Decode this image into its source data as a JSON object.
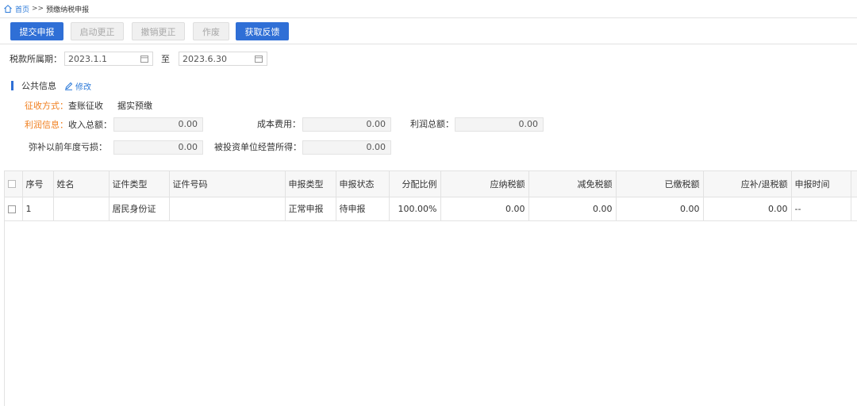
{
  "breadcrumb": {
    "home": "首页",
    "separator": ">>",
    "current": "预缴纳税申报"
  },
  "toolbar": {
    "submit": "提交申报",
    "start_correction": "启动更正",
    "cancel_correction": "撤销更正",
    "void": "作废",
    "get_feedback": "获取反馈"
  },
  "period": {
    "label": "税款所属期：",
    "start": "2023.1.1",
    "to": "至",
    "end": "2023.6.30"
  },
  "public_info": {
    "title": "公共信息",
    "edit": "修改"
  },
  "collection": {
    "label": "征收方式：",
    "value1": "查账征收",
    "value2": "据实预缴"
  },
  "profit": {
    "label": "利润信息：",
    "income_label": "收入总额：",
    "income": "0.00",
    "cost_label": "成本费用：",
    "cost": "0.00",
    "profit_label": "利润总额：",
    "profit": "0.00",
    "loss_label": "弥补以前年度亏损：",
    "loss": "0.00",
    "invest_label": "被投资单位经营所得：",
    "invest": "0.00"
  },
  "table": {
    "headers": [
      "序号",
      "姓名",
      "证件类型",
      "证件号码",
      "申报类型",
      "申报状态",
      "分配比例",
      "应纳税额",
      "减免税额",
      "已缴税额",
      "应补/退税额",
      "申报时间"
    ],
    "rows": [
      [
        "1",
        "",
        "居民身份证",
        "",
        "正常申报",
        "待申报",
        "100.00%",
        "0.00",
        "0.00",
        "0.00",
        "0.00",
        "--"
      ]
    ]
  },
  "colors": {
    "primary": "#2f6fd6",
    "link": "#2a78d8",
    "accent_orange": "#f07e1d"
  }
}
